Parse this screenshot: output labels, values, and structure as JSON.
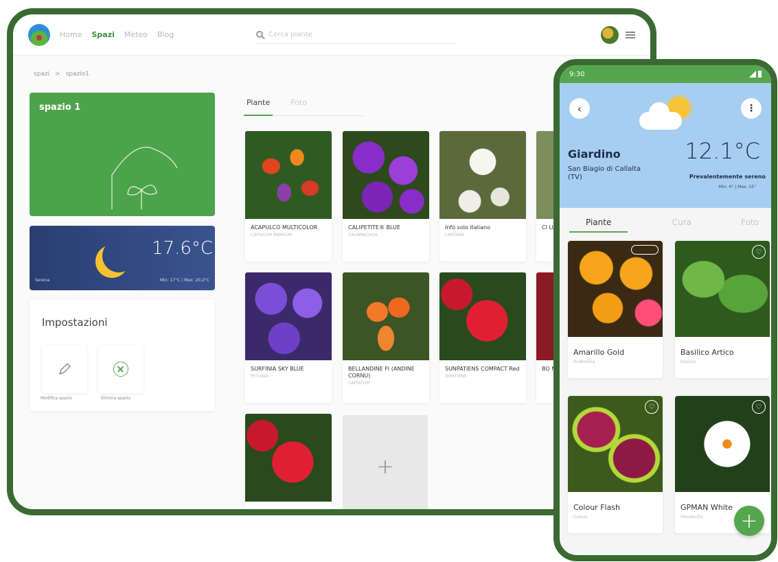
{
  "tablet": {
    "nav": {
      "links": [
        "Home",
        "Spazi",
        "Meteo",
        "Blog"
      ],
      "active_index": 1,
      "search_placeholder": "Cerca piante"
    },
    "breadcrumb": {
      "root": "spazi",
      "separator": ">",
      "current": "spazio1"
    },
    "space_card": {
      "title": "spazio 1",
      "color": "#4da34b"
    },
    "weather": {
      "temperature": "17.6°C",
      "label": "Serena",
      "minmax": "Min: 17°C | Max: 20.2°C",
      "icon": "moon-icon"
    },
    "settings": {
      "title": "Impostazioni",
      "edit_label": "Modifica spazio",
      "delete_label": "Elimina spazio",
      "edit_icon": "pencil-icon",
      "delete_icon": "close-circle-icon"
    },
    "tabs": [
      "Piante",
      "Foto"
    ],
    "plants": [
      {
        "name": "ACAPULCO MULTICOLOR",
        "sci": "CAPSICUM ANNUUM"
      },
      {
        "name": "CALIPETITE® BLUE",
        "sci": "CALIBRACHOA"
      },
      {
        "name": "Info solo italiano",
        "sci": "LANTANA"
      },
      {
        "name": "CI LU",
        "sci": ""
      },
      {
        "name": "SURFINIA SKY BLUE",
        "sci": "PETUNIA"
      },
      {
        "name": "BELLANDINE FI (ANDINE CORNU)",
        "sci": "CAPSICUM"
      },
      {
        "name": "SUNPATIENS COMPACT Red",
        "sci": "IMPATIENS"
      },
      {
        "name": "BO NO",
        "sci": ""
      },
      {
        "name": "",
        "sci": ""
      }
    ],
    "add_label": "+"
  },
  "phone": {
    "status_time": "9:30",
    "place": "Giardino",
    "location": "San Biagio di Callalta (TV)",
    "temperature": "12.1°C",
    "condition": "Prevalentemente sereno",
    "minmax": "Min: 4° | Max: 15°",
    "tabs": [
      "Piante",
      "Cura",
      "Foto"
    ],
    "plants": [
      {
        "name": "Amarillo Gold",
        "sci": "Rudbeckia"
      },
      {
        "name": "Basilico Artico",
        "sci": "Basilico"
      },
      {
        "name": "Colour Flash",
        "sci": "Coleus"
      },
      {
        "name": "GPMAN White",
        "sci": "Mandevilla"
      }
    ],
    "fab_label": "+"
  },
  "colors": {
    "brand_green": "#56a650",
    "device_frame": "#3a6a32",
    "sky": "#a7cef0"
  }
}
